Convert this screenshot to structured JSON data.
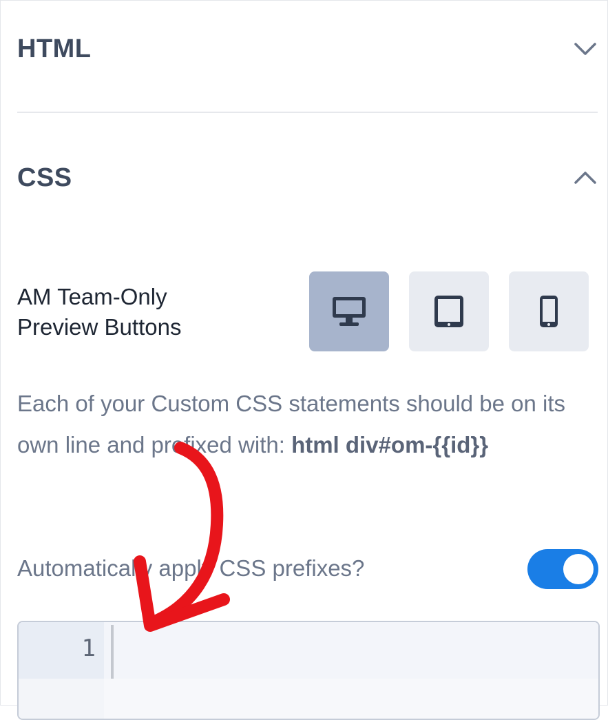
{
  "sections": {
    "html": {
      "title": "HTML",
      "expanded": false
    },
    "css": {
      "title": "CSS",
      "expanded": true
    }
  },
  "preview": {
    "label_line1": "AM Team-Only",
    "label_line2": "Preview Buttons",
    "buttons": [
      {
        "name": "desktop",
        "icon": "desktop-icon",
        "active": true
      },
      {
        "name": "tablet",
        "icon": "tablet-icon",
        "active": false
      },
      {
        "name": "mobile",
        "icon": "mobile-icon",
        "active": false
      }
    ]
  },
  "description": {
    "text": "Each of your Custom CSS statements should be on its own line and prefixed with: ",
    "code": "html div#om-{{id}}"
  },
  "auto_prefix": {
    "label": "Automatically apply CSS prefixes?",
    "enabled": true
  },
  "editor": {
    "line_numbers": [
      "1"
    ],
    "content": ""
  },
  "colors": {
    "accent": "#1a7ee6",
    "active_button": "#a7b4cc",
    "annotation_arrow": "#e8151b"
  }
}
